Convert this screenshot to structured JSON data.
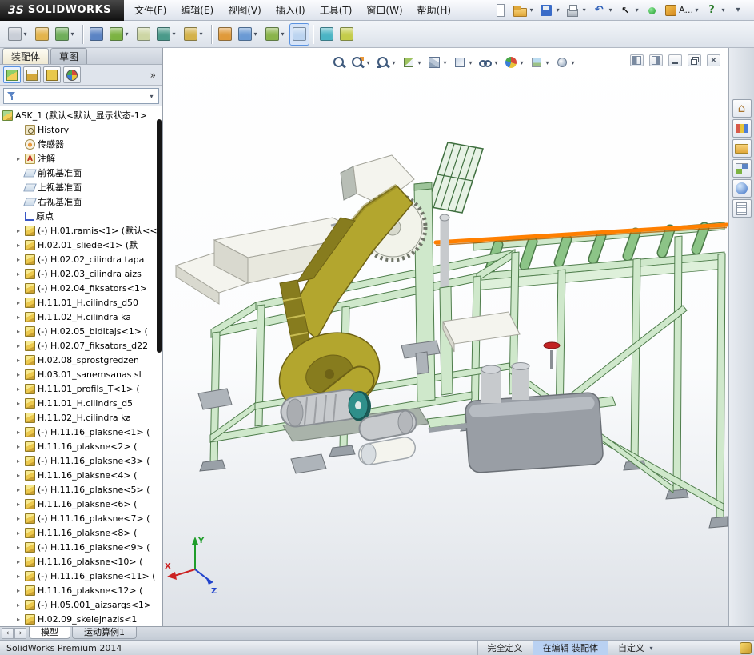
{
  "window": {
    "logo_mark": "3S",
    "logo_text": "SOLIDWORKS",
    "menus": [
      "文件(F)",
      "编辑(E)",
      "视图(V)",
      "插入(I)",
      "工具(T)",
      "窗口(W)",
      "帮助(H)"
    ],
    "quick_tools": [
      {
        "name": "new-document"
      },
      {
        "name": "open",
        "caret": true
      },
      {
        "name": "save",
        "caret": true
      },
      {
        "name": "print",
        "caret": true
      },
      {
        "name": "undo",
        "glyph": "↶",
        "caret": true
      },
      {
        "name": "select",
        "glyph": "↖",
        "caret": true
      },
      {
        "name": "rebuild"
      },
      {
        "name": "options",
        "label": "A...",
        "caret": true
      },
      {
        "name": "help",
        "glyph": "?",
        "caret": true
      },
      {
        "name": "collapse",
        "glyph": "▾"
      }
    ]
  },
  "command_bar": {
    "items": [
      {
        "name": "insert-components",
        "color": "#c9ced7",
        "caret": true
      },
      {
        "name": "mate",
        "color": "#e3b44c"
      },
      {
        "name": "linear-component-pattern",
        "color": "#6fae5a",
        "caret": true
      },
      {
        "sep": true
      },
      {
        "name": "smart-fasteners",
        "color": "#5b84c4"
      },
      {
        "name": "move-component",
        "color": "#7cb342",
        "caret": true
      },
      {
        "name": "show-hidden-components",
        "color": "#cdd6a4"
      },
      {
        "name": "assembly-features",
        "color": "#4a9a8a",
        "caret": true
      },
      {
        "name": "reference-geometry",
        "color": "#d4b24a",
        "caret": true
      },
      {
        "sep": true
      },
      {
        "name": "new-motion-study",
        "color": "#e09a3a"
      },
      {
        "name": "bill-of-materials",
        "color": "#6a9ad4",
        "caret": true
      },
      {
        "name": "exploded-view",
        "color": "#8ab44a",
        "caret": true
      },
      {
        "name": "instant3d",
        "color": "#bcd4f0",
        "active": true
      },
      {
        "sep": true
      },
      {
        "name": "take-snapshot",
        "color": "#4ab4c4"
      },
      {
        "name": "isolate",
        "color": "#c4cc4a"
      }
    ]
  },
  "left_panel": {
    "cm_tabs": [
      {
        "label": "装配体",
        "active": true
      },
      {
        "label": "草图"
      }
    ],
    "fm_tabs": [
      {
        "name": "featuremanager",
        "active": true
      },
      {
        "name": "propertymanager"
      },
      {
        "name": "configurationmanager"
      },
      {
        "name": "displaymanager"
      }
    ],
    "fm_more": "»",
    "feature_tree": {
      "items": [
        {
          "root": true,
          "label": "ASK_1 (默认<默认_显示状态-1>",
          "icon": "assembly",
          "arrow": "none"
        },
        {
          "label": "History",
          "icon": "history",
          "arrow": "none"
        },
        {
          "label": "传感器",
          "icon": "sensor",
          "arrow": "none"
        },
        {
          "label": "注解",
          "icon": "annotation",
          "arrow": "right"
        },
        {
          "label": "前视基准面",
          "icon": "plane",
          "arrow": "none"
        },
        {
          "label": "上视基准面",
          "icon": "plane",
          "arrow": "none"
        },
        {
          "label": "右视基准面",
          "icon": "plane",
          "arrow": "none"
        },
        {
          "label": "原点",
          "icon": "origin",
          "arrow": "none"
        },
        {
          "label": "(-) H.01.ramis<1> (默认<<",
          "icon": "part",
          "arrow": "right"
        },
        {
          "label": "H.02.01_sliede<1> (默",
          "icon": "part",
          "arrow": "right"
        },
        {
          "label": "(-) H.02.02_cilindra tapa",
          "icon": "part",
          "arrow": "right"
        },
        {
          "label": "(-) H.02.03_cilindra aizs",
          "icon": "part",
          "arrow": "right"
        },
        {
          "label": "(-) H.02.04_fiksators<1>",
          "icon": "part",
          "arrow": "right"
        },
        {
          "label": "H.11.01_H.cilindrs_d50",
          "icon": "part",
          "arrow": "right"
        },
        {
          "label": "H.11.02_H.cilindra ka",
          "icon": "part",
          "arrow": "right"
        },
        {
          "label": "(-) H.02.05_biditajs<1> (",
          "icon": "part",
          "arrow": "right"
        },
        {
          "label": "(-) H.02.07_fiksators_d22",
          "icon": "part",
          "arrow": "right"
        },
        {
          "label": "H.02.08_sprostgredzen",
          "icon": "part",
          "arrow": "right"
        },
        {
          "label": "H.03.01_sanemsanas sl",
          "icon": "part",
          "arrow": "right"
        },
        {
          "label": "H.11.01_profils_T<1> (",
          "icon": "part",
          "arrow": "right"
        },
        {
          "label": "H.11.01_H.cilindrs_d5",
          "icon": "part",
          "arrow": "right"
        },
        {
          "label": "H.11.02_H.cilindra ka",
          "icon": "part",
          "arrow": "right"
        },
        {
          "label": "(-) H.11.16_plaksne<1> (",
          "icon": "part",
          "arrow": "right"
        },
        {
          "label": "H.11.16_plaksne<2> (",
          "icon": "part",
          "arrow": "right"
        },
        {
          "label": "(-) H.11.16_plaksne<3> (",
          "icon": "part",
          "arrow": "right"
        },
        {
          "label": "H.11.16_plaksne<4> (",
          "icon": "part",
          "arrow": "right"
        },
        {
          "label": "(-) H.11.16_plaksne<5> (",
          "icon": "part",
          "arrow": "right"
        },
        {
          "label": "H.11.16_plaksne<6> (",
          "icon": "part",
          "arrow": "right"
        },
        {
          "label": "(-) H.11.16_plaksne<7> (",
          "icon": "part",
          "arrow": "right"
        },
        {
          "label": "H.11.16_plaksne<8> (",
          "icon": "part",
          "arrow": "right"
        },
        {
          "label": "(-) H.11.16_plaksne<9> (",
          "icon": "part",
          "arrow": "right"
        },
        {
          "label": "H.11.16_plaksne<10> (",
          "icon": "part",
          "arrow": "right"
        },
        {
          "label": "(-) H.11.16_plaksne<11> (",
          "icon": "part",
          "arrow": "right"
        },
        {
          "label": "H.11.16_plaksne<12> (",
          "icon": "part",
          "arrow": "right"
        },
        {
          "label": "(-) H.05.001_aizsargs<1>",
          "icon": "part",
          "arrow": "right"
        },
        {
          "label": "H.02.09_skelejnazis<1",
          "icon": "part",
          "arrow": "right"
        }
      ]
    }
  },
  "viewport": {
    "hud": [
      {
        "name": "zoom-fit"
      },
      {
        "name": "zoom-area",
        "caret": true
      },
      {
        "name": "previous-view",
        "caret": true
      },
      {
        "name": "section-view",
        "caret": true
      },
      {
        "name": "view-orientation",
        "caret": true
      },
      {
        "name": "display-style",
        "caret": true
      },
      {
        "name": "hide-show-items",
        "caret": true
      },
      {
        "name": "edit-appearance",
        "caret": true
      },
      {
        "name": "apply-scene",
        "caret": true
      },
      {
        "name": "view-settings",
        "caret": true
      }
    ],
    "window_buttons": [
      {
        "name": "dock-left"
      },
      {
        "name": "dock-right"
      },
      {
        "name": "minimize"
      },
      {
        "name": "restore"
      },
      {
        "name": "close"
      }
    ],
    "triad": {
      "x": "X",
      "y": "Y",
      "z": "Z"
    },
    "model_colors": {
      "frame": "#cfe8cb",
      "frame_edge": "#4f7d4c",
      "roller": "#8cc487",
      "roller_edge": "#4c7a49",
      "olive": "#b3a62e",
      "olive_dark": "#877c1e",
      "olive_edge": "#6e6216",
      "steel": "#c7cacd",
      "steel_dark": "#9da0a4",
      "tank": "#999ea5",
      "tank_top": "#b7bcc2",
      "teal": "#2f8f8a",
      "orange": "#ff7f00",
      "white_part": "#f4f4ee",
      "red": "#c22222"
    }
  },
  "task_pane": {
    "items": [
      {
        "name": "solidworks-resources"
      },
      {
        "name": "design-library"
      },
      {
        "name": "file-explorer"
      },
      {
        "name": "view-palette"
      },
      {
        "name": "appearances-scenes"
      },
      {
        "name": "custom-properties"
      }
    ]
  },
  "bottom_bar": {
    "nav": [
      {
        "name": "scroll-first",
        "glyph": "‹"
      },
      {
        "name": "scroll-last",
        "glyph": "›"
      }
    ],
    "tabs": [
      {
        "label": "模型",
        "active": true
      },
      {
        "label": "运动算例1"
      }
    ]
  },
  "status_bar": {
    "left": "SolidWorks Premium 2014",
    "cells": [
      {
        "label": "完全定义"
      },
      {
        "label": "在编辑 装配体",
        "highlight": true
      },
      {
        "label": "自定义",
        "caret": true
      }
    ]
  }
}
